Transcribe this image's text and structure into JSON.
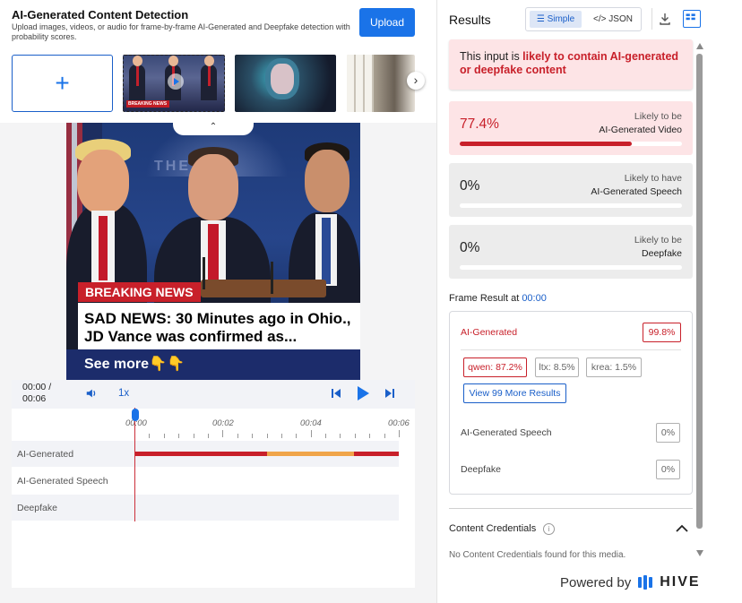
{
  "header": {
    "title": "AI-Generated Content Detection",
    "description": "Upload images, videos, or audio for frame-by-frame AI-Generated and Deepfake detection with probability scores.",
    "upload_label": "Upload",
    "add_symbol": "+"
  },
  "media": {
    "thumbnail_badge": "BREAKING NEWS",
    "next_symbol": "›",
    "collapse_symbol": "⌃",
    "breaking_label": "BREAKING NEWS",
    "headline": "SAD NEWS: 30 Minutes ago in Ohio., JD Vance was confirmed as...",
    "ticker": "See more👇👇",
    "watermark": "THE WH"
  },
  "player": {
    "time_current": "00:00 /",
    "time_total": "00:06",
    "speed": "1x",
    "tick_labels": [
      "00:00",
      "00:02",
      "00:04",
      "00:06"
    ],
    "tracks": [
      {
        "label": "AI-Generated"
      },
      {
        "label": "AI-Generated Speech"
      },
      {
        "label": "Deepfake"
      }
    ],
    "ai_track_segments": [
      {
        "from": 0.0,
        "to": 0.5,
        "color": "#c8202a"
      },
      {
        "from": 0.5,
        "to": 0.83,
        "color": "#f0a54a"
      },
      {
        "from": 0.83,
        "to": 1.0,
        "color": "#c8202a"
      }
    ]
  },
  "results": {
    "title": "Results",
    "mode_simple": "Simple",
    "mode_json": "</> JSON",
    "alert_prefix": "This input is ",
    "alert_bold": "likely to contain AI-generated or deepfake content",
    "cards": [
      {
        "pct": "77.4%",
        "lbl1": "Likely to be",
        "lbl2": "AI-Generated Video",
        "fill": 0.774,
        "bg": "#fde4e6",
        "pct_color": "#c8202a"
      },
      {
        "pct": "0%",
        "lbl1": "Likely to have",
        "lbl2": "AI-Generated Speech",
        "fill": 0,
        "bg": "#ececec",
        "pct_color": "#222"
      },
      {
        "pct": "0%",
        "lbl1": "Likely to be",
        "lbl2": "Deepfake",
        "fill": 0,
        "bg": "#ececec",
        "pct_color": "#222"
      }
    ],
    "frame_title": "Frame Result at ",
    "frame_time": "00:00",
    "frame": {
      "ai_label": "AI-Generated",
      "ai_score": "99.8%",
      "models": [
        "qwen: 87.2%",
        "ltx: 8.5%",
        "krea: 1.5%"
      ],
      "more_label": "View 99 More Results",
      "speech_label": "AI-Generated Speech",
      "speech_score": "0%",
      "deepfake_label": "Deepfake",
      "deepfake_score": "0%"
    },
    "cc_title": "Content Credentials",
    "cc_info": "i",
    "cc_message": "No Content Credentials found for this media.",
    "powered_by": "Powered by",
    "brand": "HIVE"
  },
  "colors": {
    "accent": "#1a73e8",
    "danger": "#c8202a",
    "warning": "#f0a54a"
  }
}
